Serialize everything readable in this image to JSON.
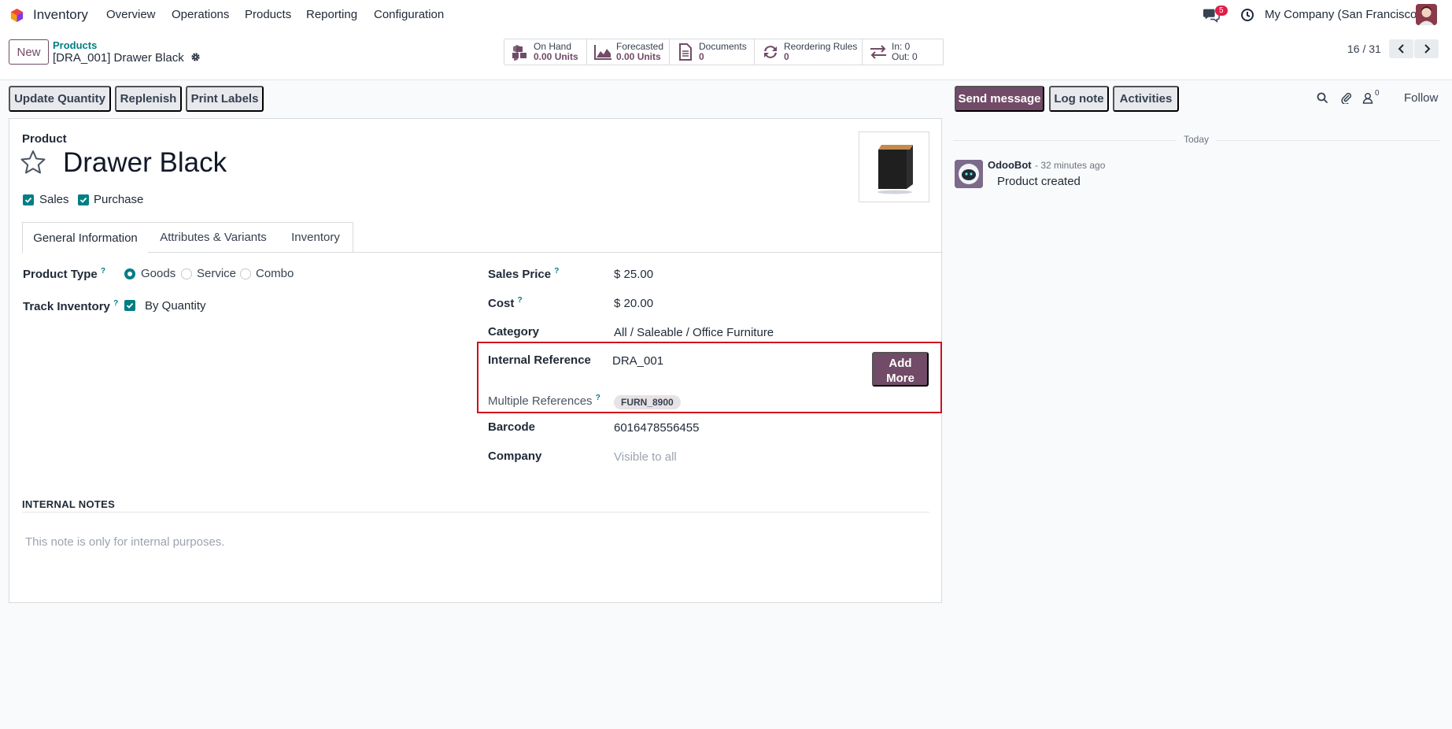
{
  "nav": {
    "app_name": "Inventory",
    "menu": [
      "Overview",
      "Operations",
      "Products",
      "Reporting",
      "Configuration"
    ],
    "message_count": "5",
    "company": "My Company (San Francisco)"
  },
  "control": {
    "new_label": "New",
    "breadcrumb_parent": "Products",
    "breadcrumb_current": "[DRA_001] Drawer Black",
    "smart_buttons": [
      {
        "label": "On Hand",
        "value": "0.00 Units",
        "icon": "cubes-icon"
      },
      {
        "label": "Forecasted",
        "value": "0.00 Units",
        "icon": "area-chart-icon"
      },
      {
        "label": "Documents",
        "value": "0",
        "icon": "document-icon"
      },
      {
        "label": "Reordering Rules",
        "value": "0",
        "icon": "refresh-icon"
      },
      {
        "label": "In: 0",
        "value": "Out: 0",
        "icon": "exchange-icon"
      }
    ],
    "pager": "16 / 31"
  },
  "actions": {
    "update_quantity": "Update Quantity",
    "replenish": "Replenish",
    "print_labels": "Print Labels"
  },
  "chatter_actions": {
    "send_message": "Send message",
    "log_note": "Log note",
    "activities": "Activities",
    "followers_count": "0",
    "follow": "Follow"
  },
  "product": {
    "label": "Product",
    "name": "Drawer Black",
    "sales_label": "Sales",
    "purchase_label": "Purchase",
    "tabs": [
      "General Information",
      "Attributes & Variants",
      "Inventory"
    ]
  },
  "fields": {
    "product_type_label": "Product Type",
    "product_type_options": [
      "Goods",
      "Service",
      "Combo"
    ],
    "product_type_selected": "Goods",
    "track_inventory_label": "Track Inventory",
    "track_inventory_value": "By Quantity",
    "sales_price_label": "Sales Price",
    "sales_price": "$ 25.00",
    "cost_label": "Cost",
    "cost": "$ 20.00",
    "category_label": "Category",
    "category": "All / Saleable / Office Furniture",
    "internal_reference_label": "Internal Reference",
    "internal_reference": "DRA_001",
    "add_more": "Add More",
    "multiple_references_label": "Multiple References",
    "multiple_references_tag": "FURN_8900",
    "barcode_label": "Barcode",
    "barcode": "6016478556455",
    "company_label": "Company",
    "company_placeholder": "Visible to all",
    "help_mark": "?"
  },
  "notes": {
    "title": "INTERNAL NOTES",
    "placeholder": "This note is only for internal purposes."
  },
  "chatter": {
    "date_separator": "Today",
    "author": "OdooBot",
    "time": "- 32 minutes ago",
    "body": "Product created"
  },
  "colors": {
    "brand": "#714B67",
    "accent": "#017e84",
    "highlight": "#d10f1e"
  }
}
